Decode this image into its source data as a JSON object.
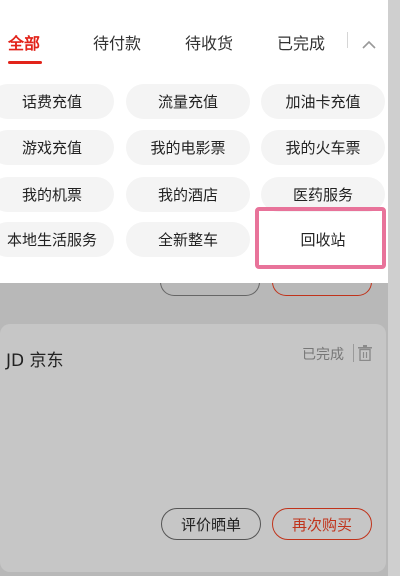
{
  "tabs": [
    {
      "label": "全部"
    },
    {
      "label": "待付款"
    },
    {
      "label": "待收货"
    },
    {
      "label": "已完成"
    }
  ],
  "services": [
    {
      "label": "话费充值"
    },
    {
      "label": "流量充值"
    },
    {
      "label": "加油卡充值"
    },
    {
      "label": "游戏充值"
    },
    {
      "label": "我的电影票"
    },
    {
      "label": "我的火车票"
    },
    {
      "label": "我的机票"
    },
    {
      "label": "我的酒店"
    },
    {
      "label": "医药服务"
    },
    {
      "label": "本地生活服务"
    },
    {
      "label": "全新整车"
    },
    {
      "label": "回收站"
    }
  ],
  "order": {
    "store": "JD 京东",
    "status": "已完成",
    "eval_label": "评价晒单",
    "rebuy_label": "再次购买"
  },
  "colors": {
    "accent": "#e2231a",
    "highlight": "#e8739a"
  }
}
